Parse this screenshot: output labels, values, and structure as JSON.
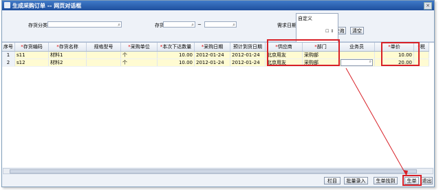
{
  "window": {
    "title": "生成采购订单 -- 网页对话框",
    "close_glyph": "×"
  },
  "filters": {
    "inventory_category_label": "存货分类",
    "inventory_label": "存货",
    "range_separator": "~",
    "demand_date_label": "需求日期",
    "demand_date_value": "自定义",
    "search_button": "查询",
    "clear_button": "清空"
  },
  "grid": {
    "columns": [
      "序号",
      "存货编码",
      "存货名称",
      "规格型号",
      "采购单位",
      "本次下达数量",
      "采购日期",
      "预计到货日期",
      "供应商",
      "部门",
      "业务员",
      "单价",
      "税"
    ],
    "required_columns": [
      "存货编码",
      "存货名称",
      "采购单位",
      "本次下达数量",
      "采购日期",
      "供应商",
      "部门",
      "单价",
      "税"
    ],
    "rows": [
      [
        "1",
        "s11",
        "材料1",
        "",
        "个",
        "10.00",
        "2012-01-24",
        "2012-01-24",
        "北京用友",
        "采购部",
        "",
        "10.00",
        ""
      ],
      [
        "2",
        "s12",
        "材料2",
        "",
        "个",
        "10.00",
        "2012-01-24",
        "2012-01-24",
        "北京用友",
        "采购部",
        "",
        "20.00",
        ""
      ]
    ]
  },
  "footer": {
    "buttons": [
      "栏目",
      "批量录入",
      "生单找到",
      "生单",
      "退出"
    ]
  },
  "colors": {
    "highlight": "#d81f26",
    "title_bar": "#2a5caa",
    "row_bg": "#fffbd2"
  }
}
